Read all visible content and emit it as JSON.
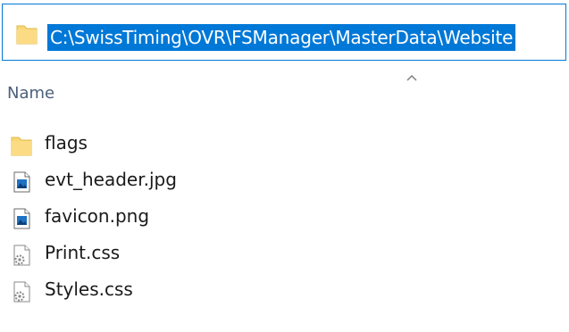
{
  "address_bar": {
    "path": "C:\\SwissTiming\\OVR\\FSManager\\MasterData\\Website",
    "icon": "folder-icon"
  },
  "column_header": {
    "name_label": "Name",
    "sort_icon": "sort-ascending-icon"
  },
  "files": [
    {
      "name": "flags",
      "icon": "folder-icon"
    },
    {
      "name": "evt_header.jpg",
      "icon": "image-file-icon"
    },
    {
      "name": "favicon.png",
      "icon": "image-file-icon"
    },
    {
      "name": "Print.css",
      "icon": "css-settings-file-icon"
    },
    {
      "name": "Styles.css",
      "icon": "css-settings-file-icon"
    }
  ],
  "colors": {
    "selection": "#0078d7",
    "folder": "#f8d775",
    "header_text": "#4c607a"
  }
}
